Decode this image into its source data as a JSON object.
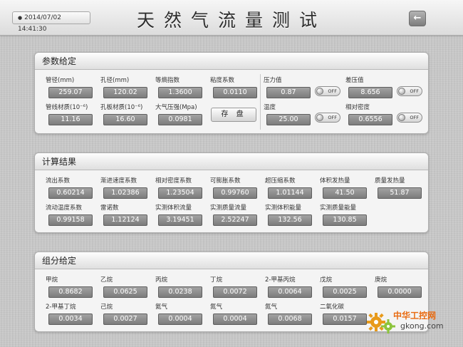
{
  "header": {
    "date": "2014/07/02 14:41:30",
    "title": "天然气流量测试",
    "back_icon": "arrow-left-icon"
  },
  "params": {
    "title": "参数给定",
    "fields": [
      {
        "label": "管径(mm)",
        "value": "259.07"
      },
      {
        "label": "孔径(mm)",
        "value": "120.02"
      },
      {
        "label": "等熵指数",
        "value": "1.3600"
      },
      {
        "label": "粘度系数",
        "value": "0.0110"
      },
      {
        "label": "管线材质(10⁻⁶)",
        "value": "11.16"
      },
      {
        "label": "孔板材质(10⁻⁶)",
        "value": "16.60"
      },
      {
        "label": "大气压强(Mpa)",
        "value": "0.0981"
      },
      {
        "label": "压力值",
        "value": "0.87"
      },
      {
        "label": "差压值",
        "value": "8.656"
      },
      {
        "label": "温度",
        "value": "25.00"
      },
      {
        "label": "相对密度",
        "value": "0.6556"
      }
    ],
    "save_label": "存 盘",
    "toggle_label": "OFF"
  },
  "results": {
    "title": "计算结果",
    "fields": [
      {
        "label": "流出系数",
        "value": "0.60214"
      },
      {
        "label": "渐进速度系数",
        "value": "1.02386"
      },
      {
        "label": "相对密度系数",
        "value": "1.23504"
      },
      {
        "label": "可膨胀系数",
        "value": "0.99760"
      },
      {
        "label": "超压缩系数",
        "value": "1.01144"
      },
      {
        "label": "体积发热量",
        "value": "41.50"
      },
      {
        "label": "质量发热量",
        "value": "51.87"
      },
      {
        "label": "流动温度系数",
        "value": "0.99158"
      },
      {
        "label": "雷诺数",
        "value": "1.12124"
      },
      {
        "label": "实测体积流量",
        "value": "3.19451"
      },
      {
        "label": "实测质量流量",
        "value": "2.52247"
      },
      {
        "label": "实测体积能量",
        "value": "132.56"
      },
      {
        "label": "实测质量能量",
        "value": "130.85"
      }
    ]
  },
  "components": {
    "title": "组分给定",
    "fields": [
      {
        "label": "甲烷",
        "value": "0.8682"
      },
      {
        "label": "乙烷",
        "value": "0.0625"
      },
      {
        "label": "丙烷",
        "value": "0.0238"
      },
      {
        "label": "丁烷",
        "value": "0.0072"
      },
      {
        "label": "2-甲基丙烷",
        "value": "0.0064"
      },
      {
        "label": "戊烷",
        "value": "0.0025"
      },
      {
        "label": "庚烷",
        "value": "0.0000"
      },
      {
        "label": "2-甲基丁烷",
        "value": "0.0034"
      },
      {
        "label": "己烷",
        "value": "0.0027"
      },
      {
        "label": "氦气",
        "value": "0.0004"
      },
      {
        "label": "氮气",
        "value": "0.0004"
      },
      {
        "label": "氮气",
        "value": "0.0068"
      },
      {
        "label": "二氧化碳",
        "value": "0.0157"
      }
    ]
  },
  "watermark": {
    "text": "中华工控网",
    "sub": "gkong.com"
  }
}
